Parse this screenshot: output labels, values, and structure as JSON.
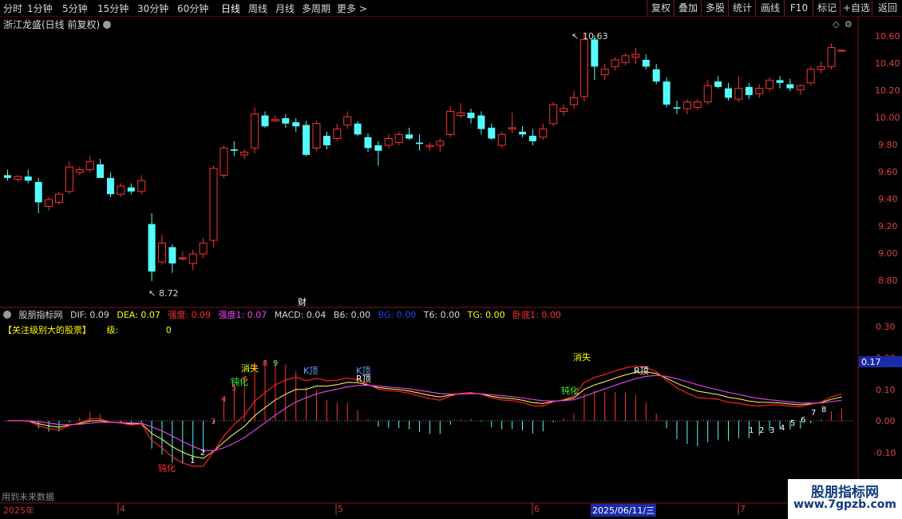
{
  "toolbar": {
    "periods": [
      "分时",
      "1分钟",
      "5分钟",
      "15分钟",
      "30分钟",
      "60分钟",
      "日线",
      "周线",
      "月线",
      "多周期",
      "更多 >"
    ],
    "active": "日线",
    "right": [
      "复权",
      "叠加",
      "多股",
      "统计",
      "画线",
      "F10",
      "标记",
      "+自选",
      "返回"
    ]
  },
  "stock": {
    "title": "浙江龙盛(日线 前复权)"
  },
  "price_axis": [
    "10.60",
    "10.40",
    "10.20",
    "10.00",
    "9.80",
    "9.60",
    "9.40",
    "9.20",
    "9.00",
    "8.80"
  ],
  "annotations": {
    "high": "10.63",
    "low": "8.72",
    "finance": "财"
  },
  "indicator": {
    "name": "股朋指标网",
    "values": [
      {
        "label": "DIF: 0.09",
        "color": "#d8d8d8"
      },
      {
        "label": "DEA: 0.07",
        "color": "#ffff00"
      },
      {
        "label": "强度: 0.09",
        "color": "#ff3030"
      },
      {
        "label": "强度1: 0.07",
        "color": "#ff40ff"
      },
      {
        "label": "MACD: 0.04",
        "color": "#d8d8d8"
      },
      {
        "label": "B6: 0.00",
        "color": "#d8d8d8"
      },
      {
        "label": "BG: 0.00",
        "color": "#2040ff"
      },
      {
        "label": "T6: 0.00",
        "color": "#d8d8d8"
      },
      {
        "label": "TG: 0.00",
        "color": "#ffff00"
      },
      {
        "label": "卧底1: 0.00",
        "color": "#ff3030"
      }
    ],
    "focus": "【关注级别大的股票】",
    "level_label": "级:",
    "level_value": "0",
    "axis": [
      "0.30",
      "0.20",
      "0.10",
      "0.00",
      "-0.10"
    ],
    "current": "0.17",
    "signals": [
      "钝化",
      "消失",
      "K顶",
      "R顶",
      "消失",
      "R顶",
      "钝化",
      "钝化"
    ],
    "counts": [
      "1",
      "2",
      "3",
      "4",
      "5",
      "6",
      "7",
      "8",
      "9",
      "1",
      "2",
      "3",
      "4",
      "5",
      "6",
      "7",
      "8"
    ]
  },
  "timeline": {
    "labels": [
      "2025年",
      "4",
      "5",
      "6",
      "7"
    ],
    "current_date": "2025/06/11/三",
    "future_note": "用到未来数据"
  },
  "watermark": {
    "name": "股朋指标网",
    "url": "www.7gpzb.com"
  },
  "colors": {
    "up": "#ff3232",
    "down": "#54fcfc",
    "border": "#7a1a1a"
  },
  "chart_data": {
    "type": "candlestick",
    "price_range": [
      8.7,
      10.7
    ],
    "candles": [
      [
        9.58,
        9.62,
        9.54,
        9.56
      ],
      [
        9.55,
        9.58,
        9.53,
        9.57
      ],
      [
        9.57,
        9.62,
        9.52,
        9.54
      ],
      [
        9.53,
        9.56,
        9.3,
        9.38
      ],
      [
        9.35,
        9.42,
        9.32,
        9.4
      ],
      [
        9.38,
        9.46,
        9.36,
        9.44
      ],
      [
        9.46,
        9.68,
        9.44,
        9.64
      ],
      [
        9.6,
        9.64,
        9.58,
        9.62
      ],
      [
        9.62,
        9.72,
        9.6,
        9.68
      ],
      [
        9.66,
        9.7,
        9.56,
        9.56
      ],
      [
        9.56,
        9.6,
        9.42,
        9.44
      ],
      [
        9.44,
        9.52,
        9.42,
        9.5
      ],
      [
        9.49,
        9.52,
        9.44,
        9.46
      ],
      [
        9.46,
        9.58,
        9.44,
        9.54
      ],
      [
        9.22,
        9.3,
        8.8,
        8.87
      ],
      [
        8.94,
        9.14,
        8.92,
        9.08
      ],
      [
        9.05,
        9.07,
        8.86,
        8.93
      ],
      [
        8.97,
        9.02,
        8.95,
        8.97
      ],
      [
        8.93,
        9.03,
        8.88,
        9.0
      ],
      [
        9.0,
        9.12,
        8.97,
        9.08
      ],
      [
        9.1,
        9.65,
        9.05,
        9.63
      ],
      [
        9.58,
        9.8,
        9.56,
        9.78
      ],
      [
        9.77,
        9.83,
        9.72,
        9.76
      ],
      [
        9.73,
        9.77,
        9.7,
        9.75
      ],
      [
        9.78,
        10.08,
        9.74,
        10.03
      ],
      [
        10.02,
        10.05,
        9.93,
        9.94
      ],
      [
        9.98,
        10.02,
        9.97,
        9.99
      ],
      [
        10.0,
        10.03,
        9.93,
        9.96
      ],
      [
        9.97,
        10.0,
        9.9,
        9.94
      ],
      [
        9.95,
        9.98,
        9.72,
        9.73
      ],
      [
        9.78,
        9.98,
        9.76,
        9.96
      ],
      [
        9.87,
        9.9,
        9.77,
        9.8
      ],
      [
        9.85,
        9.96,
        9.83,
        9.92
      ],
      [
        9.95,
        10.05,
        9.92,
        10.01
      ],
      [
        9.96,
        9.98,
        9.87,
        9.88
      ],
      [
        9.86,
        9.89,
        9.75,
        9.78
      ],
      [
        9.8,
        9.83,
        9.65,
        9.76
      ],
      [
        9.8,
        9.88,
        9.78,
        9.85
      ],
      [
        9.82,
        9.9,
        9.8,
        9.88
      ],
      [
        9.88,
        9.93,
        9.84,
        9.85
      ],
      [
        9.82,
        9.88,
        9.76,
        9.81
      ],
      [
        9.79,
        9.82,
        9.76,
        9.8
      ],
      [
        9.8,
        9.85,
        9.75,
        9.83
      ],
      [
        9.88,
        10.09,
        9.86,
        10.05
      ],
      [
        10.02,
        10.11,
        10.0,
        10.04
      ],
      [
        10.04,
        10.07,
        9.96,
        10.0
      ],
      [
        10.02,
        10.05,
        9.88,
        9.92
      ],
      [
        9.93,
        9.96,
        9.84,
        9.85
      ],
      [
        9.8,
        9.9,
        9.78,
        9.88
      ],
      [
        9.92,
        10.04,
        9.89,
        9.93
      ],
      [
        9.9,
        9.94,
        9.86,
        9.88
      ],
      [
        9.87,
        9.92,
        9.8,
        9.83
      ],
      [
        9.86,
        9.96,
        9.84,
        9.92
      ],
      [
        9.96,
        10.12,
        9.94,
        10.1
      ],
      [
        10.05,
        10.1,
        10.02,
        10.07
      ],
      [
        10.1,
        10.2,
        10.07,
        10.15
      ],
      [
        10.16,
        10.63,
        10.12,
        10.58
      ],
      [
        10.58,
        10.61,
        10.28,
        10.38
      ],
      [
        10.32,
        10.4,
        10.28,
        10.36
      ],
      [
        10.38,
        10.45,
        10.35,
        10.43
      ],
      [
        10.41,
        10.48,
        10.39,
        10.46
      ],
      [
        10.45,
        10.52,
        10.4,
        10.47
      ],
      [
        10.43,
        10.47,
        10.36,
        10.38
      ],
      [
        10.36,
        10.4,
        10.25,
        10.27
      ],
      [
        10.27,
        10.3,
        10.08,
        10.1
      ],
      [
        10.08,
        10.13,
        10.03,
        10.07
      ],
      [
        10.07,
        10.14,
        10.03,
        10.12
      ],
      [
        10.08,
        10.14,
        10.06,
        10.12
      ],
      [
        10.12,
        10.28,
        10.1,
        10.24
      ],
      [
        10.27,
        10.31,
        10.22,
        10.23
      ],
      [
        10.22,
        10.26,
        10.13,
        10.15
      ],
      [
        10.14,
        10.31,
        10.12,
        10.22
      ],
      [
        10.23,
        10.26,
        10.14,
        10.17
      ],
      [
        10.18,
        10.25,
        10.15,
        10.22
      ],
      [
        10.22,
        10.3,
        10.2,
        10.28
      ],
      [
        10.28,
        10.31,
        10.22,
        10.26
      ],
      [
        10.25,
        10.29,
        10.2,
        10.22
      ],
      [
        10.21,
        10.25,
        10.17,
        10.24
      ],
      [
        10.26,
        10.38,
        10.24,
        10.36
      ],
      [
        10.36,
        10.42,
        10.33,
        10.38
      ],
      [
        10.38,
        10.55,
        10.36,
        10.52
      ],
      [
        10.5,
        10.5,
        10.5,
        10.5
      ]
    ]
  }
}
